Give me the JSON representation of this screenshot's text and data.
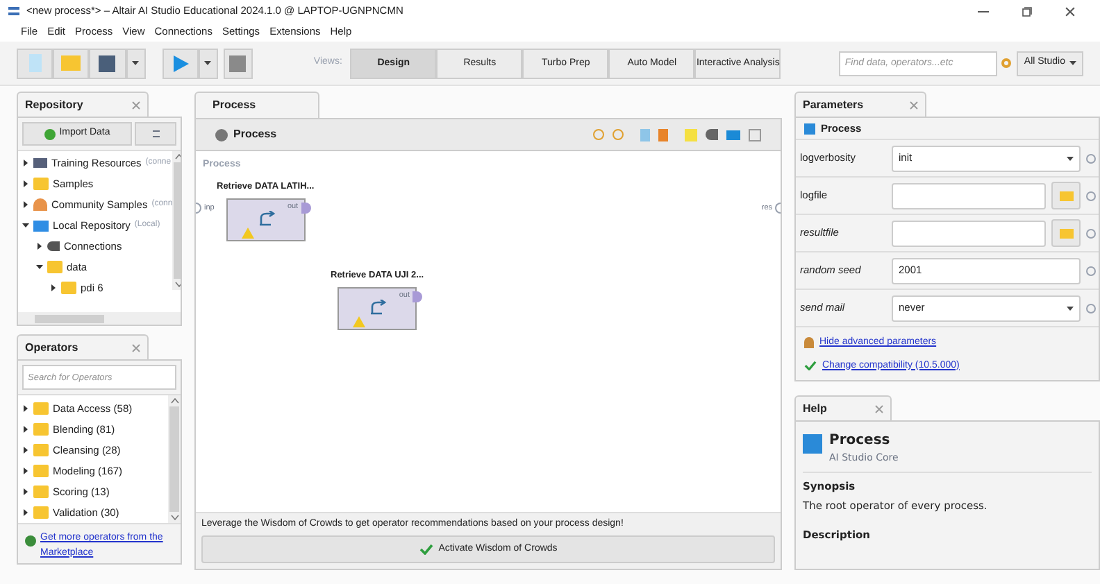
{
  "window": {
    "title": "<new process*> – Altair AI Studio Educational 2024.1.0 @ LAPTOP-UGNPNCMN"
  },
  "menu": [
    "File",
    "Edit",
    "Process",
    "View",
    "Connections",
    "Settings",
    "Extensions",
    "Help"
  ],
  "toolbar": {
    "views_label": "Views:",
    "views": [
      {
        "label": "Design",
        "selected": true
      },
      {
        "label": "Results",
        "selected": false
      },
      {
        "label": "Turbo Prep",
        "selected": false
      },
      {
        "label": "Auto Model",
        "selected": false
      },
      {
        "label": "Interactive Analysis",
        "selected": false
      }
    ],
    "search": {
      "placeholder": "Find data, operators...etc"
    },
    "scope": "All Studio"
  },
  "repository": {
    "title": "Repository",
    "import_button": "Import Data",
    "tree": [
      {
        "label": "Training Resources",
        "note": "(conne",
        "kind": "training",
        "expanded": false
      },
      {
        "label": "Samples",
        "kind": "folder",
        "expanded": false
      },
      {
        "label": "Community Samples",
        "note": "(conn",
        "kind": "community",
        "expanded": false
      },
      {
        "label": "Local Repository",
        "note": "(Local)",
        "kind": "local",
        "expanded": true,
        "children": [
          {
            "label": "Connections",
            "kind": "connections",
            "expanded": false
          },
          {
            "label": "data",
            "kind": "folder",
            "expanded": true,
            "children": [
              {
                "label": "pdi 6",
                "kind": "folder",
                "expanded": false
              }
            ]
          }
        ]
      }
    ]
  },
  "operators": {
    "title": "Operators",
    "search": {
      "placeholder": "Search for Operators"
    },
    "items": [
      {
        "label": "Data Access (58)",
        "expanded": false
      },
      {
        "label": "Blending (81)",
        "expanded": false
      },
      {
        "label": "Cleansing (28)",
        "expanded": false
      },
      {
        "label": "Modeling (167)",
        "expanded": false
      },
      {
        "label": "Scoring (13)",
        "expanded": false
      },
      {
        "label": "Validation (30)",
        "expanded": false
      }
    ],
    "marketplace_link": "Get more operators from the Marketplace"
  },
  "process": {
    "tab": "Process",
    "header": "Process",
    "canvas_label": "Process",
    "input_port": "inp",
    "result_port": "res",
    "nodes": [
      {
        "name": "Retrieve DATA LATIH...",
        "port": "out",
        "warning": true
      },
      {
        "name": "Retrieve DATA UJI 2...",
        "port": "out",
        "warning": true
      }
    ],
    "wisdom_text": "Leverage the Wisdom of Crowds to get operator recommendations based on your process design!",
    "wisdom_button": "Activate Wisdom of Crowds"
  },
  "parameters": {
    "title": "Parameters",
    "header": "Process",
    "params": [
      {
        "kind": "select",
        "label": "logverbosity",
        "value": "init",
        "expert": false
      },
      {
        "kind": "file",
        "label": "logfile",
        "expert": false
      },
      {
        "kind": "file",
        "label": "resultfile",
        "expert": true
      },
      {
        "kind": "text",
        "label": "random seed",
        "value": "2001",
        "expert": true
      },
      {
        "kind": "select",
        "label": "send mail",
        "value": "never",
        "expert": true
      }
    ],
    "hide_link": "Hide advanced parameters",
    "compat_link": "Change compatibility (10.5.000)"
  },
  "help": {
    "title": "Help",
    "operator": "Process",
    "source": "AI Studio Core",
    "synopsis_heading": "Synopsis",
    "synopsis": "The root operator of every process.",
    "description_heading": "Description"
  }
}
